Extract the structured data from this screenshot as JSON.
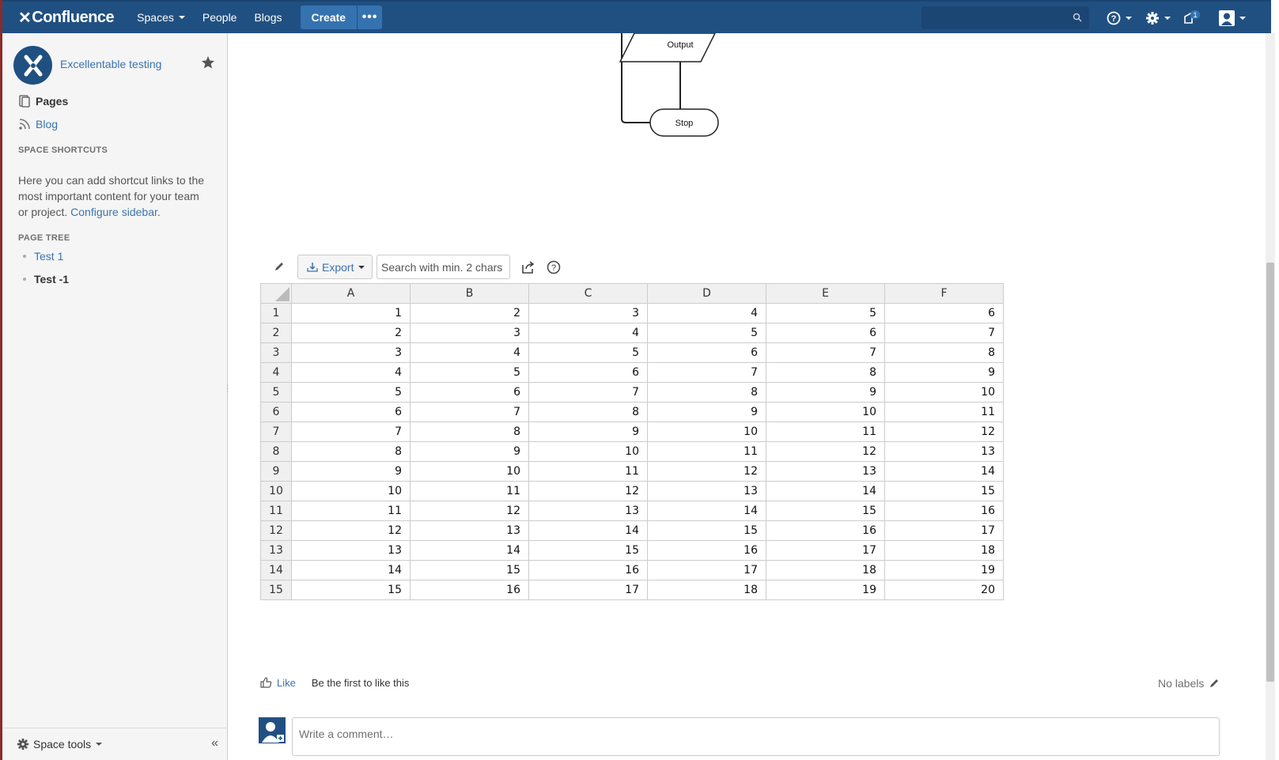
{
  "header": {
    "logo": "Confluence",
    "nav": [
      "Spaces",
      "People",
      "Blogs"
    ],
    "create_label": "Create",
    "more_label": "•••",
    "search_placeholder": "",
    "notification_count": "1",
    "brand_color": "#205081"
  },
  "sidebar": {
    "space_name": "Excellentable testing",
    "pages_label": "Pages",
    "blog_label": "Blog",
    "shortcuts_title": "SPACE SHORTCUTS",
    "shortcuts_text": "Here you can add shortcut links to the most important content for your team or project.",
    "configure_link": "Configure sidebar",
    "shortcuts_period": ".",
    "page_tree_title": "PAGE TREE",
    "tree_items": [
      "Test 1",
      "Test -1"
    ],
    "space_tools": "Space tools",
    "collapse": "«"
  },
  "flowchart": {
    "output_label": "Output",
    "stop_label": "Stop"
  },
  "table_toolbar": {
    "export_label": "Export",
    "search_placeholder": "Search with min. 2 chars"
  },
  "spreadsheet": {
    "columns": [
      "A",
      "B",
      "C",
      "D",
      "E",
      "F"
    ],
    "rows": [
      {
        "n": "1",
        "cells": [
          "1",
          "2",
          "3",
          "4",
          "5",
          "6"
        ]
      },
      {
        "n": "2",
        "cells": [
          "2",
          "3",
          "4",
          "5",
          "6",
          "7"
        ]
      },
      {
        "n": "3",
        "cells": [
          "3",
          "4",
          "5",
          "6",
          "7",
          "8"
        ]
      },
      {
        "n": "4",
        "cells": [
          "4",
          "5",
          "6",
          "7",
          "8",
          "9"
        ]
      },
      {
        "n": "5",
        "cells": [
          "5",
          "6",
          "7",
          "8",
          "9",
          "10"
        ]
      },
      {
        "n": "6",
        "cells": [
          "6",
          "7",
          "8",
          "9",
          "10",
          "11"
        ]
      },
      {
        "n": "7",
        "cells": [
          "7",
          "8",
          "9",
          "10",
          "11",
          "12"
        ]
      },
      {
        "n": "8",
        "cells": [
          "8",
          "9",
          "10",
          "11",
          "12",
          "13"
        ]
      },
      {
        "n": "9",
        "cells": [
          "9",
          "10",
          "11",
          "12",
          "13",
          "14"
        ]
      },
      {
        "n": "10",
        "cells": [
          "10",
          "11",
          "12",
          "13",
          "14",
          "15"
        ]
      },
      {
        "n": "11",
        "cells": [
          "11",
          "12",
          "13",
          "14",
          "15",
          "16"
        ]
      },
      {
        "n": "12",
        "cells": [
          "12",
          "13",
          "14",
          "15",
          "16",
          "17"
        ]
      },
      {
        "n": "13",
        "cells": [
          "13",
          "14",
          "15",
          "16",
          "17",
          "18"
        ]
      },
      {
        "n": "14",
        "cells": [
          "14",
          "15",
          "16",
          "17",
          "18",
          "19"
        ]
      },
      {
        "n": "15",
        "cells": [
          "15",
          "16",
          "17",
          "18",
          "19",
          "20"
        ]
      }
    ]
  },
  "footer": {
    "like_label": "Like",
    "like_text": "Be the first to like this",
    "labels_text": "No labels",
    "comment_placeholder": "Write a comment…"
  }
}
